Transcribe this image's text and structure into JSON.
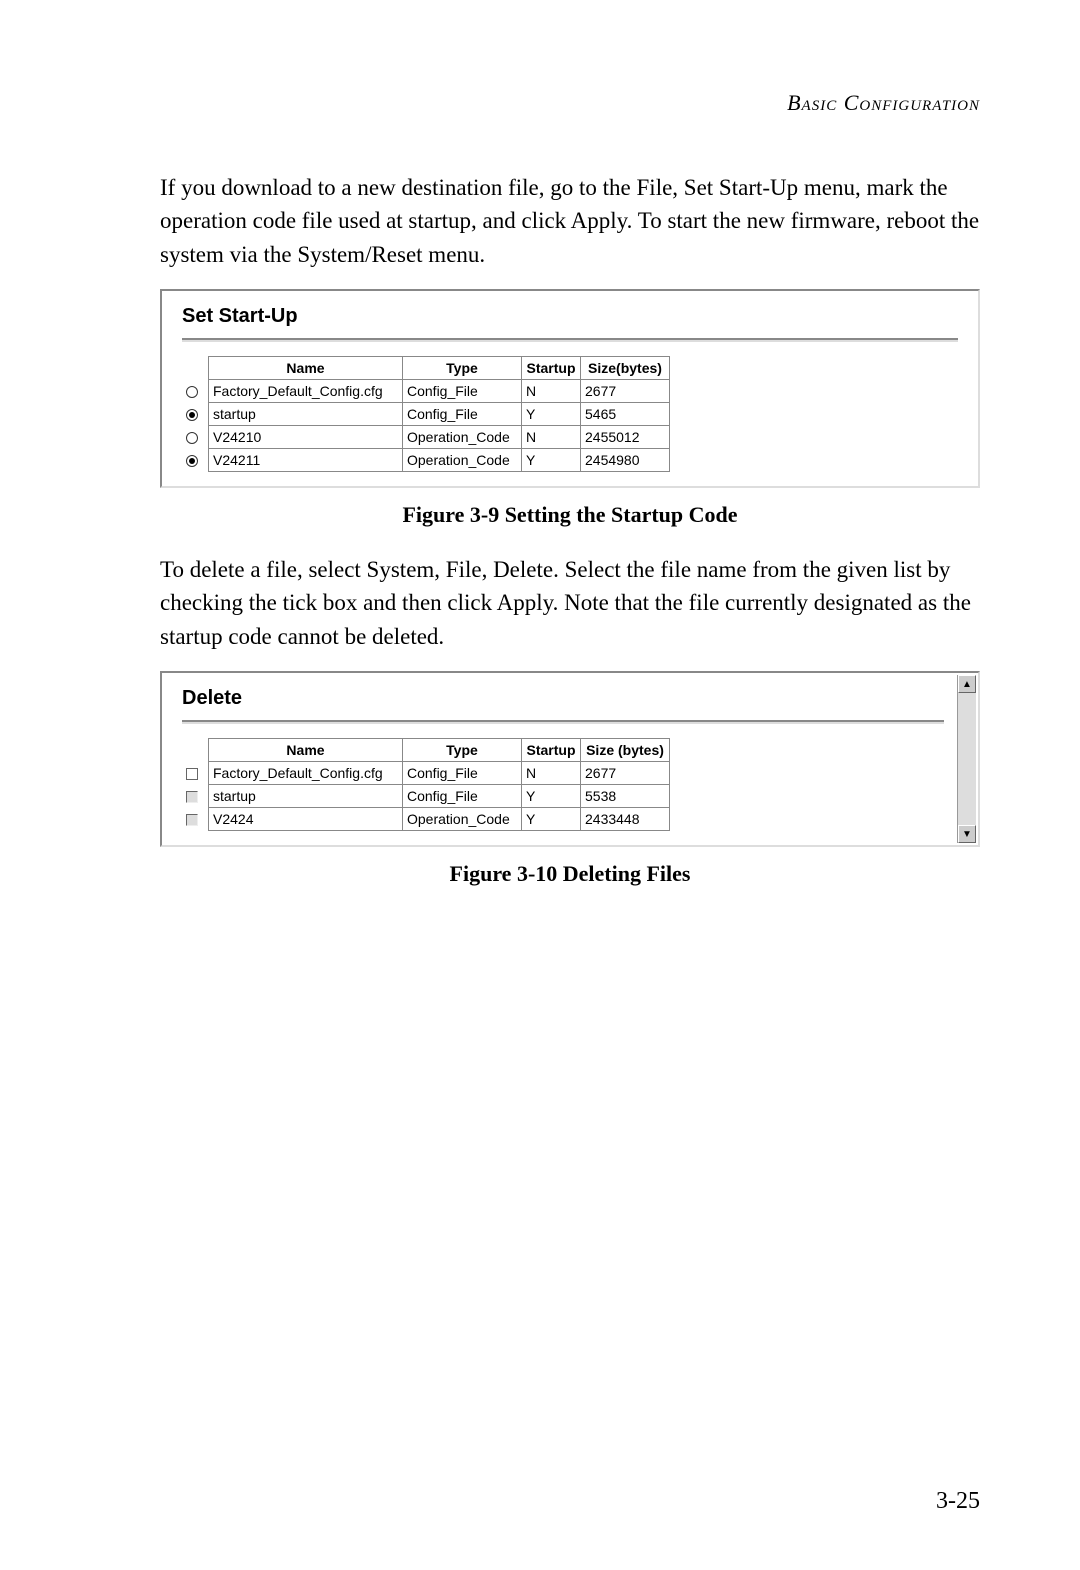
{
  "header": "Basic Configuration",
  "para1": "If you download to a new destination file, go to the File, Set Start-Up menu, mark the operation code file used at startup, and click Apply. To start the new firmware, reboot the system via the System/Reset menu.",
  "fig1": {
    "title": "Set Start-Up",
    "columns": [
      "Name",
      "Type",
      "Startup",
      "Size(bytes)"
    ],
    "rows": [
      {
        "selected": false,
        "name": "Factory_Default_Config.cfg",
        "type": "Config_File",
        "startup": "N",
        "size": "2677"
      },
      {
        "selected": true,
        "name": "startup",
        "type": "Config_File",
        "startup": "Y",
        "size": "5465"
      },
      {
        "selected": false,
        "name": "V24210",
        "type": "Operation_Code",
        "startup": "N",
        "size": "2455012"
      },
      {
        "selected": true,
        "name": "V24211",
        "type": "Operation_Code",
        "startup": "Y",
        "size": "2454980"
      }
    ],
    "caption": "Figure 3-9  Setting the Startup Code"
  },
  "para2": "To delete a file, select System, File, Delete. Select the file name from the given list by checking the tick box and then click Apply. Note that the file currently designated as the startup code cannot be deleted.",
  "fig2": {
    "title": "Delete",
    "columns": [
      "Name",
      "Type",
      "Startup",
      "Size (bytes)"
    ],
    "rows": [
      {
        "checked": false,
        "style": "unchecked",
        "name": "Factory_Default_Config.cfg",
        "type": "Config_File",
        "startup": "N",
        "size": "2677"
      },
      {
        "checked": false,
        "style": "gray",
        "name": "startup",
        "type": "Config_File",
        "startup": "Y",
        "size": "5538"
      },
      {
        "checked": false,
        "style": "gray",
        "name": "V2424",
        "type": "Operation_Code",
        "startup": "Y",
        "size": "2433448"
      }
    ],
    "caption": "Figure 3-10  Deleting Files"
  },
  "pageNumber": "3-25"
}
